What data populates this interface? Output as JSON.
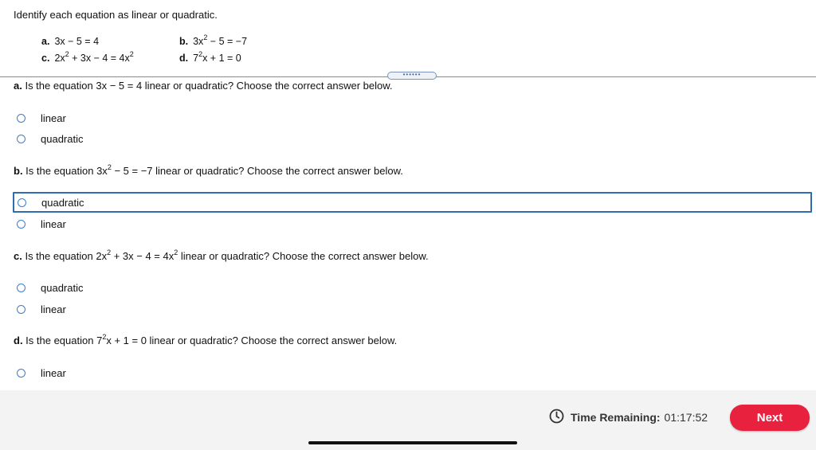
{
  "instructions": "Identify each equation as linear or quadratic.",
  "equations": {
    "a": {
      "letter": "a.",
      "pre": "3x − 5 = 4"
    },
    "b": {
      "letter": "b.",
      "pre": "3x",
      "sup": "2",
      "post": " − 5 = −7"
    },
    "c": {
      "letter": "c.",
      "pre": "2x",
      "sup1": "2",
      "mid": " + 3x − 4 = 4x",
      "sup2": "2"
    },
    "d": {
      "letter": "d.",
      "pre": "7",
      "sup": "2",
      "post": "x + 1 = 0"
    }
  },
  "handle": "••••••",
  "questions": {
    "a": {
      "letter": "a.",
      "pre": " Is the equation 3x − 5 = 4 linear or quadratic? Choose the correct answer below.",
      "options": [
        "linear",
        "quadratic"
      ]
    },
    "b": {
      "letter": "b.",
      "pre": " Is the equation 3x",
      "sup": "2",
      "post": " − 5 = −7 linear or quadratic? Choose the correct answer below.",
      "options": [
        "quadratic",
        "linear"
      ]
    },
    "c": {
      "letter": "c.",
      "pre": " Is the equation 2x",
      "sup1": "2",
      "mid": " + 3x − 4 = 4x",
      "sup2": "2",
      "post": " linear or quadratic? Choose the correct answer below.",
      "options": [
        "quadratic",
        "linear"
      ]
    },
    "d": {
      "letter": "d.",
      "pre": " Is the equation 7",
      "sup": "2",
      "post": "x + 1 = 0 linear or quadratic? Choose the correct answer below.",
      "options": [
        "linear"
      ]
    }
  },
  "footer": {
    "time_label": "Time Remaining:",
    "time_value": "01:17:52",
    "next_label": "Next"
  },
  "colors": {
    "accent": "#2f6db3",
    "next": "#e8213f"
  }
}
